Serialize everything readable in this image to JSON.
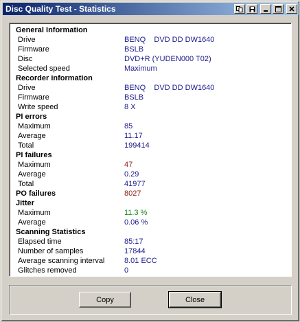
{
  "window": {
    "title": "Disc Quality Test - Statistics"
  },
  "sections": [
    {
      "header": "General Information",
      "rows": [
        {
          "label": "Drive",
          "value": "BENQ    DVD DD DW1640",
          "color": "blue"
        },
        {
          "label": "Firmware",
          "value": "BSLB",
          "color": "blue"
        },
        {
          "label": "Disc",
          "value": "DVD+R (YUDEN000 T02)",
          "color": "blue"
        },
        {
          "label": "Selected speed",
          "value": "Maximum",
          "color": "blue"
        }
      ]
    },
    {
      "header": "Recorder information",
      "rows": [
        {
          "label": "Drive",
          "value": "BENQ    DVD DD DW1640",
          "color": "blue"
        },
        {
          "label": "Firmware",
          "value": "BSLB",
          "color": "blue"
        },
        {
          "label": "Write speed",
          "value": "8 X",
          "color": "blue"
        }
      ]
    },
    {
      "header": "PI errors",
      "rows": [
        {
          "label": "Maximum",
          "value": "85",
          "color": "blue"
        },
        {
          "label": "Average",
          "value": "11.17",
          "color": "blue"
        },
        {
          "label": "Total",
          "value": "199414",
          "color": "blue"
        }
      ]
    },
    {
      "header": "PI failures",
      "rows": [
        {
          "label": "Maximum",
          "value": "47",
          "color": "red"
        },
        {
          "label": "Average",
          "value": "0.29",
          "color": "blue"
        },
        {
          "label": "Total",
          "value": "41977",
          "color": "blue"
        }
      ]
    },
    {
      "header": "PO failures",
      "header_value": "8027",
      "rows": []
    },
    {
      "header": "Jitter",
      "rows": [
        {
          "label": "Maximum",
          "value": "11.3 %",
          "color": "green"
        },
        {
          "label": "Average",
          "value": "0.06 %",
          "color": "blue"
        }
      ]
    },
    {
      "header": "Scanning Statistics",
      "rows": [
        {
          "label": "Elapsed time",
          "value": "85:17",
          "color": "blue"
        },
        {
          "label": "Number of samples",
          "value": "17844",
          "color": "blue"
        },
        {
          "label": "Average scanning interval",
          "value": "8.01 ECC",
          "color": "blue"
        },
        {
          "label": "Glitches removed",
          "value": "0",
          "color": "blue"
        }
      ]
    }
  ],
  "buttons": {
    "copy": "Copy",
    "close": "Close"
  },
  "colors": {
    "title_gradient_start": "#0a246a",
    "title_gradient_end": "#a6caf0",
    "value_blue": "#1a1a8c",
    "value_red": "#8b1a1a",
    "value_green": "#1a8a1a",
    "face": "#d4d0c8"
  },
  "icons": [
    "copy-to-clipboard-icon",
    "save-icon",
    "minimize-icon",
    "maximize-icon",
    "close-icon"
  ]
}
